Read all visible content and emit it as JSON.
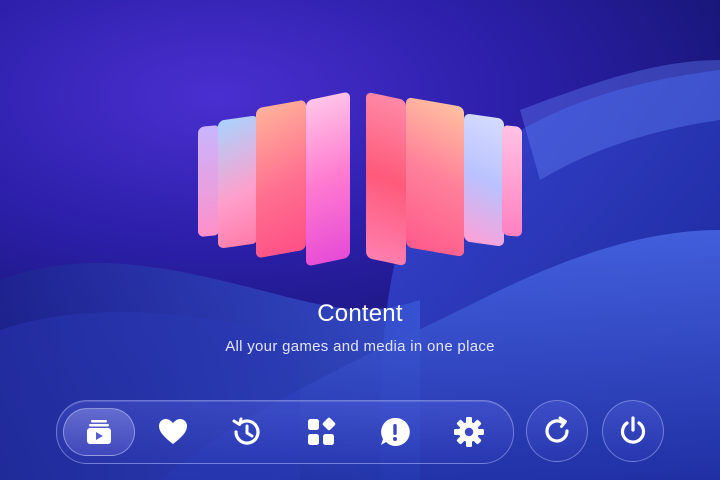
{
  "hero": {
    "title": "Content",
    "subtitle": "All your games and media in one place"
  },
  "dock": {
    "items": [
      {
        "id": "content",
        "icon": "media-library-icon",
        "active": true
      },
      {
        "id": "favorites",
        "icon": "heart-icon",
        "active": false
      },
      {
        "id": "recent",
        "icon": "history-icon",
        "active": false
      },
      {
        "id": "apps",
        "icon": "apps-grid-icon",
        "active": false
      },
      {
        "id": "notifications",
        "icon": "alert-bubble-icon",
        "active": false
      },
      {
        "id": "settings",
        "icon": "gear-icon",
        "active": false
      }
    ]
  },
  "actions": [
    {
      "id": "restart",
      "icon": "restart-icon"
    },
    {
      "id": "power",
      "icon": "power-icon"
    }
  ],
  "colors": {
    "background": "#2b1fa8",
    "accent_pink": "#ff5a8a",
    "icon": "#ffffff"
  }
}
